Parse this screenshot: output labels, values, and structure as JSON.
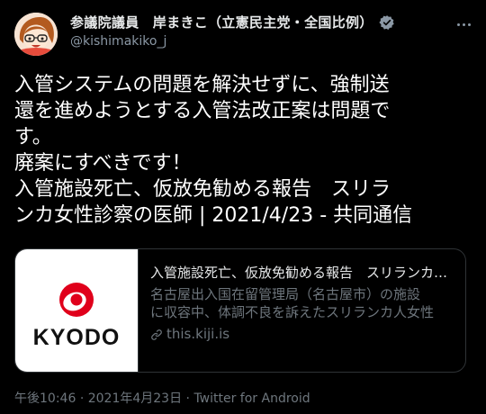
{
  "author": {
    "display_name": "参議院議員　岸まきこ（立憲民主党・全国比例）",
    "handle": "@kishimakiko_j",
    "avatar_icon": "avatar-illustration",
    "verified_icon": "verified-badge-icon"
  },
  "tweet": {
    "lines": [
      "入管システムの問題を解決せずに、強制送",
      "還を進めようとする入管法改正案は問題で",
      "す。",
      "廃案にすべきです！",
      "入管施設死亡、仮放免勧める報告　スリラ",
      "ンカ女性診察の医師 | 2021/4/23 - 共同通信"
    ]
  },
  "card": {
    "thumb_brand": "KYODO",
    "title": "入管施設死亡、仮放免勧める報告　スリランカ女性診察の医師",
    "desc_line1": "名古屋出入国在留管理局（名古屋市）の施設",
    "desc_line2": "に収容中、体調不良を訴えたスリランカ人女性",
    "domain": "this.kiji.is",
    "link_icon": "link-icon"
  },
  "meta": {
    "time": "午後10:46",
    "date": "2021年4月23日",
    "separator": "·",
    "source": "Twitter for Android"
  },
  "colors": {
    "background": "#000000",
    "text": "#ffffff",
    "secondary": "#8b98a5",
    "border": "#2f3336",
    "verified": "#8b98a5",
    "kyodo_red": "#e0001b"
  }
}
